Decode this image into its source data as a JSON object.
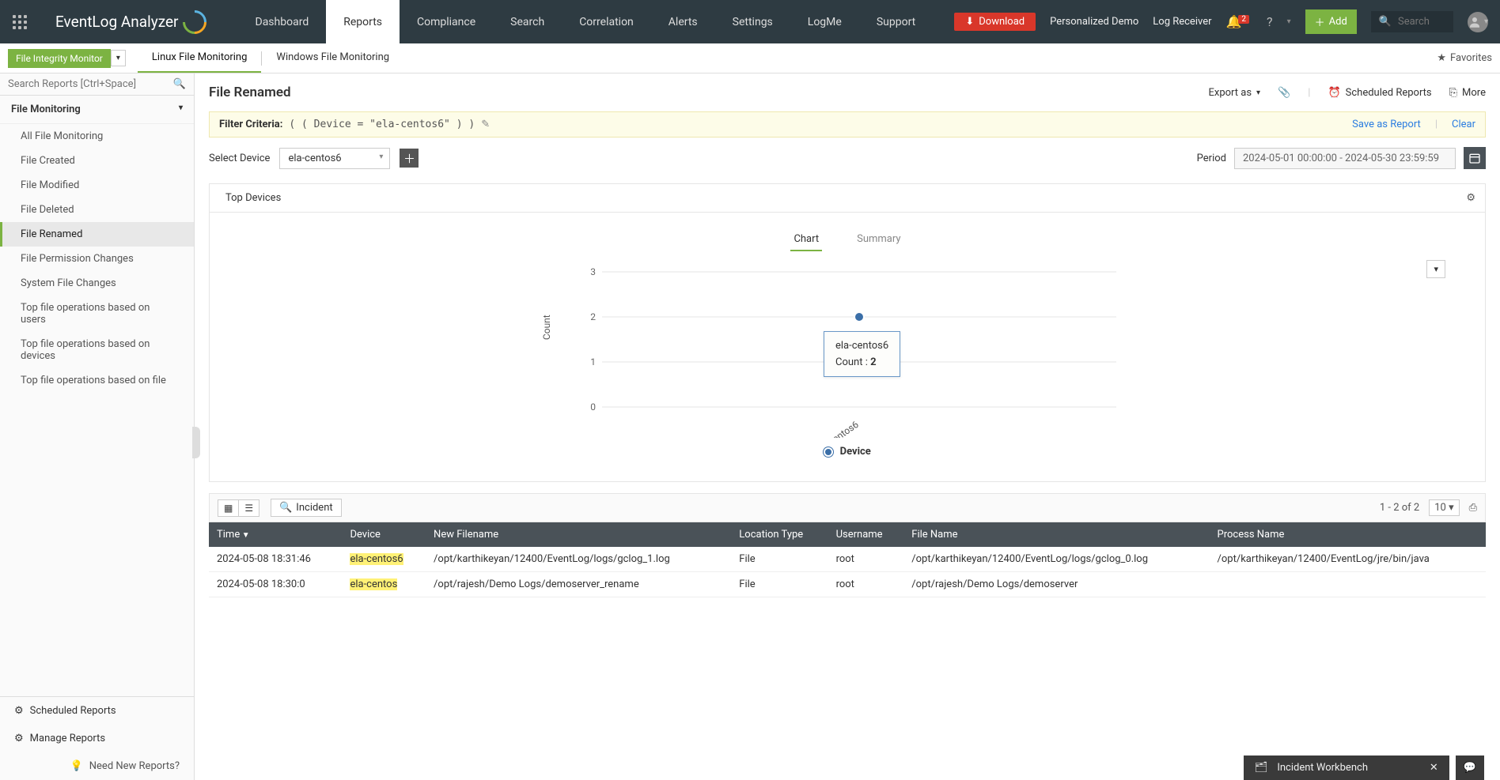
{
  "topbar": {
    "logo_text": "EventLog Analyzer",
    "nav": [
      "Dashboard",
      "Reports",
      "Compliance",
      "Search",
      "Correlation",
      "Alerts",
      "Settings",
      "LogMe",
      "Support"
    ],
    "nav_active": 1,
    "download": "Download",
    "personalized": "Personalized Demo",
    "log_receiver": "Log Receiver",
    "notif_count": "2",
    "add": "Add",
    "search_placeholder": "Search"
  },
  "subnav": {
    "fim": "File Integrity Monitor",
    "linux": "Linux File Monitoring",
    "windows": "Windows File Monitoring",
    "favorites": "Favorites"
  },
  "sidebar": {
    "search_placeholder": "Search Reports [Ctrl+Space]",
    "group": "File Monitoring",
    "items": [
      "All File Monitoring",
      "File Created",
      "File Modified",
      "File Deleted",
      "File Renamed",
      "File Permission Changes",
      "System File Changes",
      "Top file operations based on users",
      "Top file operations based on devices",
      "Top file operations based on file"
    ],
    "active": 4,
    "scheduled": "Scheduled Reports",
    "manage": "Manage Reports",
    "need_new": "Need New Reports?"
  },
  "page": {
    "title": "File Renamed",
    "export": "Export as",
    "scheduled": "Scheduled Reports",
    "more": "More"
  },
  "filter": {
    "label": "Filter Criteria:",
    "expr": "( ( Device = \"ela-centos6\" ) )",
    "save": "Save as Report",
    "clear": "Clear"
  },
  "device_row": {
    "label": "Select Device",
    "selected": "ela-centos6",
    "period_label": "Period",
    "period_value": "2024-05-01 00:00:00 - 2024-05-30 23:59:59"
  },
  "panel": {
    "tab": "Top Devices",
    "chart_tab": "Chart",
    "summary_tab": "Summary"
  },
  "tooltip": {
    "device": "ela-centos6",
    "count_label": "Count :",
    "count_val": "2"
  },
  "legend": "Device",
  "chart_yaxis": "Count",
  "chart_data": {
    "type": "line",
    "categories": [
      "ela-centos6"
    ],
    "series": [
      {
        "name": "Device",
        "values": [
          2
        ]
      }
    ],
    "ylabel": "Count",
    "ylim": [
      0,
      3
    ],
    "yticks": [
      0,
      1,
      2,
      3
    ]
  },
  "table": {
    "range": "1 - 2 of 2",
    "page_size": "10",
    "incident": "Incident",
    "headers": [
      "Time",
      "Device",
      "New Filename",
      "Location Type",
      "Username",
      "File Name",
      "Process Name"
    ],
    "rows": [
      {
        "time": "2024-05-08 18:31:46",
        "device": "ela-centos6",
        "newfile": "/opt/karthikeyan/12400/EventLog/logs/gclog_1.log",
        "loc": "File",
        "user": "root",
        "fname": "/opt/karthikeyan/12400/EventLog/logs/gclog_0.log",
        "proc": "/opt/karthikeyan/12400/EventLog/jre/bin/java"
      },
      {
        "time": "2024-05-08 18:30:0",
        "device": "ela-centos",
        "newfile": "/opt/rajesh/Demo Logs/demoserver_rename",
        "loc": "File",
        "user": "root",
        "fname": "/opt/rajesh/Demo Logs/demoserver",
        "proc": ""
      }
    ]
  },
  "workbench": "Incident Workbench"
}
